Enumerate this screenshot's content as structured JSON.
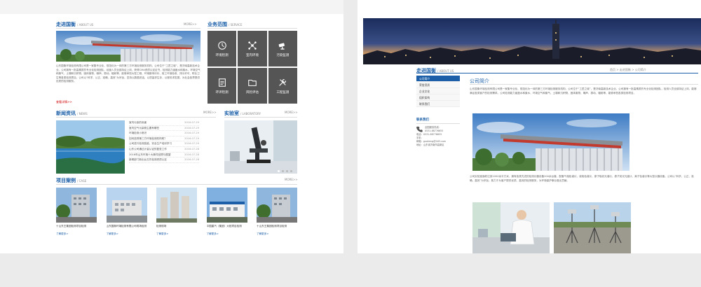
{
  "left_page": {
    "about": {
      "title": "走进国衡",
      "en": "/ ABOUT US",
      "more": "MORE>>",
      "text": "山东国衡环境检测有限公司是一家集专业化、规范化为一体的第三方环境检测服务机构，公司位于“工匠之城”，是济南高新技术企业。公司拥有一批高素质的专业化检测团队，经营人员全部持证上岗，获得CMA资质认定证书，检测能力涵盖水和废水、环境空气和废气、土壤和沉积物、固体废物、噪声、振动、辐射等，能够承担大型工程、环境影响评价、竣工环保验收、排污许可、职业卫生等各类检测项目。公司以“科学、公正、准确、高效”为宗旨，坚持以数据说话，以质量求生存，以服务求发展，为社会各界提供优质的检测服务。",
      "link": "查看详情>>"
    },
    "service": {
      "title": "业务范围",
      "en": "/ SERVICE",
      "items": [
        "环境检测",
        "室内环境",
        "污染监测",
        "环评检测",
        "风险评估",
        "工程监测"
      ]
    },
    "news": {
      "title": "新闻资讯",
      "en": "/ NEWS",
      "more": "MORE>>",
      "items": [
        {
          "t": "室内污染的危害",
          "d": "2016-07-29"
        },
        {
          "t": "室内空气污染物主要有哪些",
          "d": "2016-07-29"
        },
        {
          "t": "环境检测小常识",
          "d": "2016-07-29"
        },
        {
          "t": "如何选择第三方环境检测机构呢？",
          "d": "2016-07-29"
        },
        {
          "t": "公司进行检测技能、安全生产培训学习",
          "d": "2016-07-29"
        },
        {
          "t": "山东公司通过计量认证的复查工作",
          "d": "2016-07-28"
        },
        {
          "t": "2016年山东环境十大事件回顾与展望",
          "d": "2016-07-28"
        },
        {
          "t": "新闻部门新出台文件检测资质认定",
          "d": "2016-07-28"
        }
      ]
    },
    "lab": {
      "title": "实验室",
      "en": "/ LABORATORY",
      "more": "MORE>>"
    },
    "cases": {
      "title": "项目案例",
      "en": "/ CASE",
      "more": "MORE>>",
      "items": [
        {
          "cap": "十山东王集团检测项目检测",
          "lk": "了解更多>"
        },
        {
          "cap": "山东国衡环境检测有限公司现场检测",
          "lk": "了解更多>"
        },
        {
          "cap": "检测现场",
          "lk": "了解更多>"
        },
        {
          "cap": "中国重汽（集团）大桩项目检测",
          "lk": "了解更多>"
        },
        {
          "cap": "十山东王集团检测项目检测",
          "lk": "了解更多>"
        }
      ]
    }
  },
  "right_page": {
    "about": {
      "title": "走进国衡",
      "en": "/ ABOUT US",
      "crumb": "首页 > 走进国衡 > 公司简介"
    },
    "menu": [
      "公司简介",
      "荣誉资质",
      "企业文化",
      "组织架构",
      "联系我们"
    ],
    "contact": {
      "title": "联系我们",
      "lines": [
        "全国服务热线：",
        "0531-88776655",
        "电话：0531-88776655",
        "手机：",
        "邮箱：guoheng@163.com",
        "地址：山东省济南市高新区"
      ]
    },
    "content": {
      "title": "公司简介",
      "intro": "山东国衡环境检测有限公司是一家集专业化、规范化为一体的第三方环境检测服务机构，公司位于“工匠之城”，是济南高新技术企业。公司拥有一批高素质的专业化检测团队，检测人员全部持证上岗，能够满足各类客户的检测需求。公司检测能力涵盖水和废水、环境空气和废气、土壤和沉积物、固体废物、噪声、振动、辐射等，能够承担各类检测项目。",
      "body": "公司实验室面积达到1000余平方米，拥有各类先进的检测仪器设备300余台套，配备气相色谱仪、液相色谱仪、原子吸收光谱仪、原子荧光光度计、离子色谱仪等大型仪器设备。公司以“科学、公正、准确、高效”为宗旨，致力于为客户提供优质、高效的检测服务，为环境保护事业做出贡献。"
    }
  }
}
